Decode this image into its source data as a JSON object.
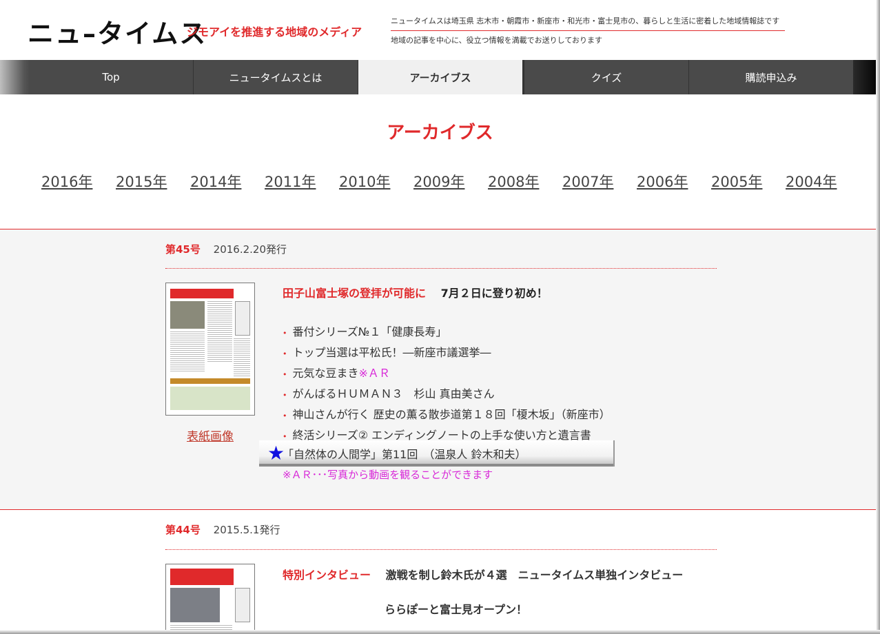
{
  "header": {
    "logo": "ニュ–タイムス",
    "tagline": "ジモアイを推進する地域のメディア",
    "desc_line1": "ニュータイムスは埼玉県 志木市・朝霞市・新座市・和光市・富士見市の、暮らしと生活に密着した地域情報誌です",
    "desc_line2": "地域の記事を中心に、役立つ情報を満載でお送りしております"
  },
  "nav": [
    {
      "label": "Top",
      "active": false
    },
    {
      "label": "ニュータイムスとは",
      "active": false
    },
    {
      "label": "アーカイブス",
      "active": true
    },
    {
      "label": "クイズ",
      "active": false
    },
    {
      "label": "購読申込み",
      "active": false
    }
  ],
  "page_title": "アーカイブス",
  "years": [
    "2016年",
    "2015年",
    "2014年",
    "2011年",
    "2010年",
    "2009年",
    "2008年",
    "2007年",
    "2006年",
    "2005年",
    "2004年"
  ],
  "issues": [
    {
      "number": "第45号",
      "date": "2016.2.20発行",
      "headline_red": "田子山富士塚の登拝が可能に",
      "headline_black": "7月２日に登り初め！",
      "cover_link": "表紙画像",
      "items": [
        {
          "text": "番付シリーズ№１「健康長寿」",
          "suffix": ""
        },
        {
          "text": "トップ当選は平松氏！―新座市議選挙―",
          "suffix": ""
        },
        {
          "text": "元気な豆まき",
          "suffix": "※ＡＲ"
        },
        {
          "text": "がんばるＨＵＭＡＮ３　杉山 真由美さん",
          "suffix": ""
        },
        {
          "text": "神山さんが行く 歴史の薫る散歩道第１８回「榎木坂」（新座市）",
          "suffix": ""
        },
        {
          "text": "終活シリーズ② エンディングノートの上手な使い方と遺言書",
          "suffix": ""
        }
      ],
      "highlight_item": "「自然体の人間学」第11回　（温泉人 鈴木和夫）",
      "ar_note": "※ＡＲ･･･写真から動画を観ることができます"
    },
    {
      "number": "第44号",
      "date": "2015.5.1発行",
      "headline_red": "特別インタビュー",
      "headline_black": "激戦を制し鈴木氏が４選　ニュータイムス単独インタビュー",
      "headline_line2": "ららぽーと富士見オープン！"
    }
  ],
  "colors": {
    "accent": "#e0292b",
    "nav_bg": "#4a4a4a",
    "ar": "#d829d8",
    "star": "#1010e0"
  }
}
